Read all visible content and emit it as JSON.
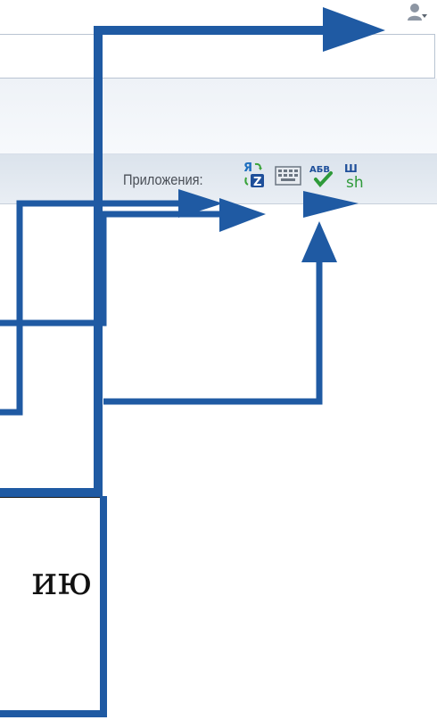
{
  "toolbar": {
    "apps_label": "Приложения:",
    "apps": [
      {
        "name": "translit-icon",
        "glyph_top": "Я",
        "glyph_bottom": "Z"
      },
      {
        "name": "keyboard-icon"
      },
      {
        "name": "spellcheck-icon",
        "glyph": "АБВ"
      },
      {
        "name": "sh-icon",
        "glyph_top": "Ш",
        "glyph_bottom": "sh"
      }
    ]
  },
  "caption": {
    "text": "ию"
  },
  "colors": {
    "arrow": "#1f5aa3",
    "toolbar": "#dfe6ee",
    "label": "#4a4f57"
  }
}
